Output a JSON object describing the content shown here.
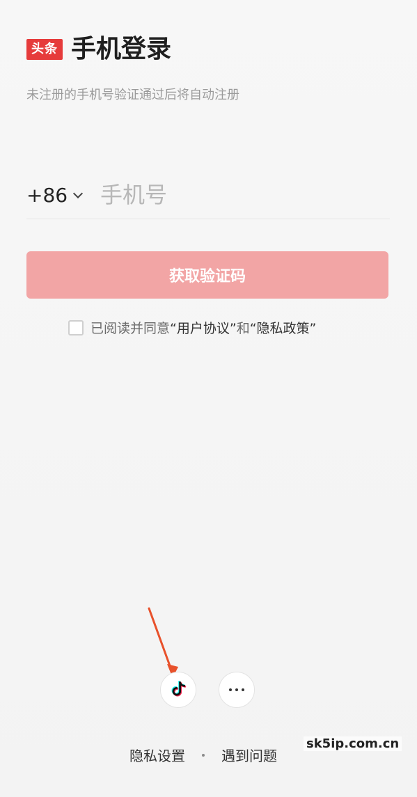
{
  "header": {
    "logo_text": "头条",
    "title": "手机登录",
    "subtitle": "未注册的手机号验证通过后将自动注册"
  },
  "phone": {
    "country_code": "+86",
    "placeholder": "手机号",
    "value": ""
  },
  "actions": {
    "get_code_label": "获取验证码"
  },
  "agreement": {
    "checked": false,
    "prefix": "已阅读并同意",
    "user_agreement": "“用户协议”",
    "and": "和",
    "privacy_policy": "“隐私政策”"
  },
  "social": {
    "buttons": [
      {
        "name": "tiktok-login",
        "icon": "tiktok-icon"
      },
      {
        "name": "more-login-options",
        "icon": "more-icon"
      }
    ]
  },
  "footer": {
    "privacy_settings": "隐私设置",
    "need_help": "遇到问题"
  },
  "watermark": "sk5ip.com.cn",
  "colors": {
    "brand_red": "#e63b3b",
    "button_disabled": "#f2a5a5",
    "arrow": "#e8512b"
  }
}
